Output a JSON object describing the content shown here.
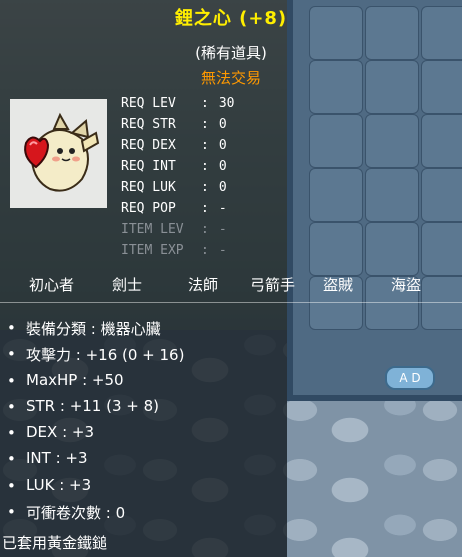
{
  "item": {
    "name": "鋰之心 (+8)",
    "rarity": "(稀有道具)",
    "trade": "無法交易",
    "icon": "android-heart-icon"
  },
  "requirements": [
    {
      "label": "REQ LEV",
      "value": "30",
      "enabled": true
    },
    {
      "label": "REQ STR",
      "value": "0",
      "enabled": true
    },
    {
      "label": "REQ DEX",
      "value": "0",
      "enabled": true
    },
    {
      "label": "REQ INT",
      "value": "0",
      "enabled": true
    },
    {
      "label": "REQ LUK",
      "value": "0",
      "enabled": true
    },
    {
      "label": "REQ POP",
      "value": "-",
      "enabled": true
    },
    {
      "label": "ITEM LEV",
      "value": "-",
      "enabled": false
    },
    {
      "label": "ITEM EXP",
      "value": "-",
      "enabled": false
    }
  ],
  "jobs": [
    "初心者",
    "劍士",
    "法師",
    "弓箭手",
    "盜賊",
    "海盜"
  ],
  "stats": [
    "裝備分類 : 機器心臟",
    "攻擊力 : +16 (0 + 16)",
    "MaxHP : +50",
    "STR : +11 (3 + 8)",
    "DEX : +3",
    "INT : +3",
    "LUK : +3",
    "可衝卷次數 : 0"
  ],
  "footer": "已套用黃金鐵鎚",
  "bullet": "•",
  "colon": ":",
  "inventory": {
    "button_label": "A D"
  },
  "colors": {
    "name": "#ffee00",
    "trade": "#ff9900",
    "text": "#ffffff",
    "disabled": "#8a9096"
  }
}
